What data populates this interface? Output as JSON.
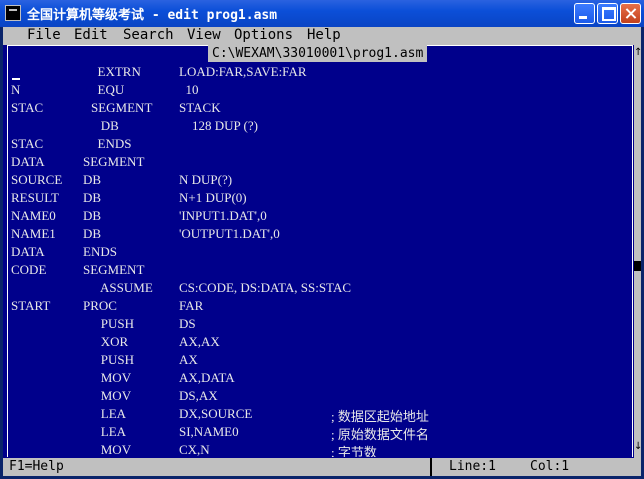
{
  "window": {
    "title": "全国计算机等级考试 - edit prog1.asm"
  },
  "menu": [
    "File",
    "Edit",
    "Search",
    "View",
    "Options",
    "Help"
  ],
  "editor": {
    "filename": "C:\\WEXAM\\33010001\\prog1.asm",
    "lines": [
      {
        "c1": "",
        "c2": "",
        "c3": "  EXTRN",
        "c4": "LOAD:FAR,SAVE:FAR",
        "c5": ""
      },
      {
        "c1": "N",
        "c2": "",
        "c3": "  EQU",
        "c4": "  10",
        "c5": ""
      },
      {
        "c1": "STAC",
        "c2": "",
        "c3": "SEGMENT",
        "c4": "STACK",
        "c5": ""
      },
      {
        "c1": "",
        "c2": "",
        "c3": "   DB",
        "c4": "    128 DUP (?)",
        "c5": ""
      },
      {
        "c1": "STAC",
        "c2": "",
        "c3": "  ENDS",
        "c4": "",
        "c5": ""
      },
      {
        "c1": "DATA",
        "c2": "SEGMENT",
        "c3": "",
        "c4": "",
        "c5": ""
      },
      {
        "c1": "SOURCE",
        "c2": "DB",
        "c3": "",
        "c4": "N DUP(?)",
        "c5": ""
      },
      {
        "c1": "RESULT",
        "c2": "DB",
        "c3": "",
        "c4": "N+1 DUP(0)",
        "c5": ""
      },
      {
        "c1": "NAME0",
        "c2": "DB",
        "c3": "",
        "c4": "'INPUT1.DAT',0",
        "c5": ""
      },
      {
        "c1": "NAME1",
        "c2": "DB",
        "c3": "",
        "c4": "'OUTPUT1.DAT',0",
        "c5": ""
      },
      {
        "c1": "DATA",
        "c2": "ENDS",
        "c3": "",
        "c4": "",
        "c5": ""
      },
      {
        "c1": "CODE",
        "c2": "SEGMENT",
        "c3": "",
        "c4": "",
        "c5": ""
      },
      {
        "c1": "",
        "c2": "",
        "c3": "   ASSUME",
        "c4": "CS:CODE, DS:DATA, SS:STAC",
        "c5": ""
      },
      {
        "c1": "START",
        "c2": "PROC",
        "c3": "",
        "c4": "FAR",
        "c5": ""
      },
      {
        "c1": "",
        "c2": "",
        "c3": "   PUSH",
        "c4": "DS",
        "c5": ""
      },
      {
        "c1": "",
        "c2": "",
        "c3": "   XOR",
        "c4": "AX,AX",
        "c5": ""
      },
      {
        "c1": "",
        "c2": "",
        "c3": "   PUSH",
        "c4": "AX",
        "c5": ""
      },
      {
        "c1": "",
        "c2": "",
        "c3": "   MOV",
        "c4": "AX,DATA",
        "c5": ""
      },
      {
        "c1": "",
        "c2": "",
        "c3": "   MOV",
        "c4": "DS,AX",
        "c5": ""
      },
      {
        "c1": "",
        "c2": "",
        "c3": "   LEA",
        "c4": "DX,SOURCE",
        "c5": "; 数据区起始地址"
      },
      {
        "c1": "",
        "c2": "",
        "c3": "   LEA",
        "c4": "SI,NAME0",
        "c5": "; 原始数据文件名"
      },
      {
        "c1": "",
        "c2": "",
        "c3": "   MOV",
        "c4": "CX,N",
        "c5": "; 字节数"
      }
    ]
  },
  "status": {
    "help": "F1=Help",
    "line": "Line:1",
    "col": "Col:1"
  }
}
